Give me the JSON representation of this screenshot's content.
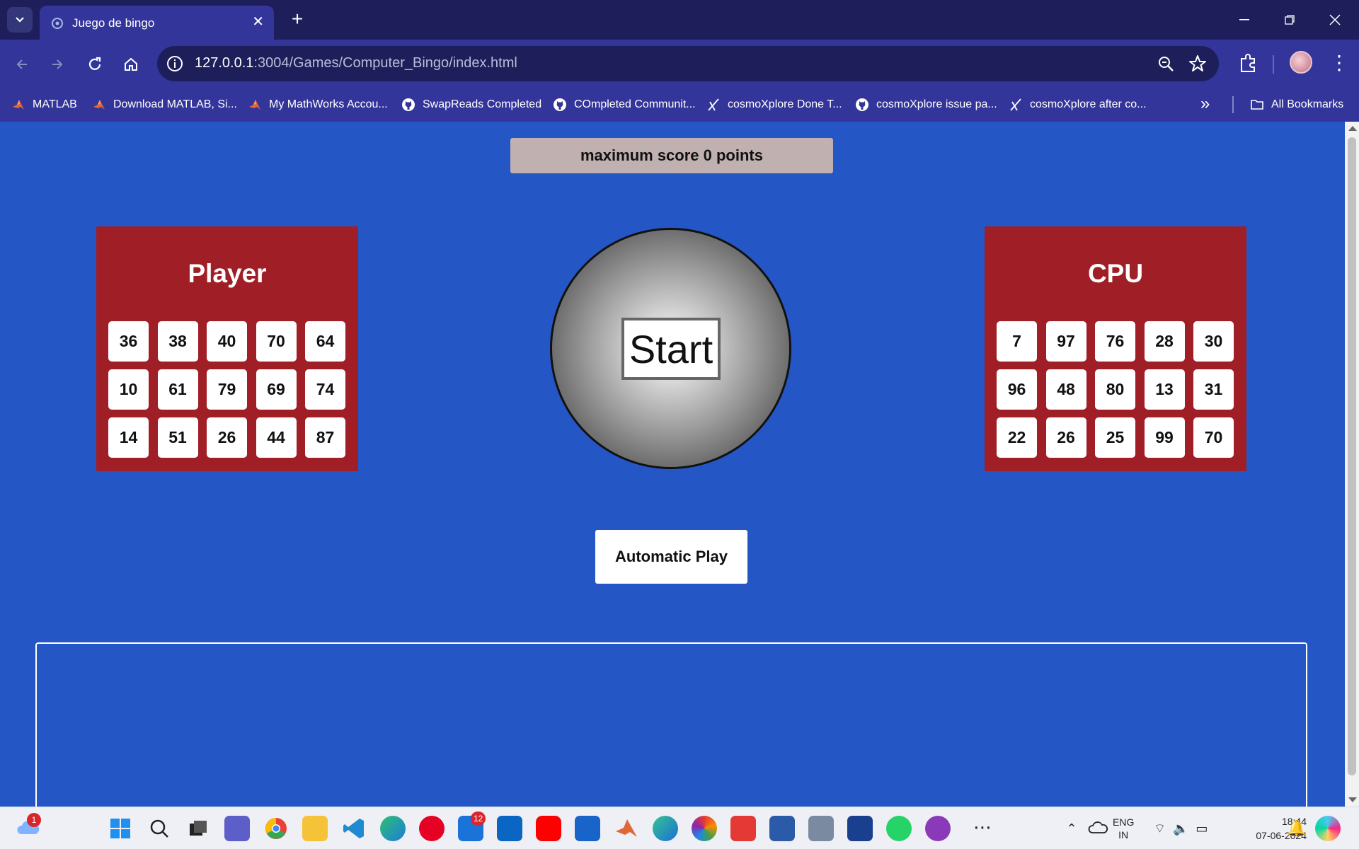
{
  "browser": {
    "tab_title": "Juego de bingo",
    "url_host": "127.0.0.1",
    "url_rest": ":3004/Games/Computer_Bingo/index.html",
    "bookmarks": [
      {
        "label": "MATLAB",
        "icon": "matlab-icon"
      },
      {
        "label": "Download MATLAB, Si...",
        "icon": "matlab-icon"
      },
      {
        "label": "My MathWorks Accou...",
        "icon": "matlab-icon"
      },
      {
        "label": "SwapReads Completed",
        "icon": "github-icon"
      },
      {
        "label": "COmpleted Communit...",
        "icon": "github-icon"
      },
      {
        "label": "cosmoXplore Done T...",
        "icon": "cosmo-icon"
      },
      {
        "label": "cosmoXplore issue pa...",
        "icon": "github-icon"
      },
      {
        "label": "cosmoXplore after co...",
        "icon": "cosmo-icon"
      }
    ],
    "all_bookmarks": "All Bookmarks"
  },
  "game": {
    "score_text": "maximum score 0 points",
    "player": {
      "title": "Player",
      "numbers": [
        "36",
        "38",
        "40",
        "70",
        "64",
        "10",
        "61",
        "79",
        "69",
        "74",
        "14",
        "51",
        "26",
        "44",
        "87"
      ]
    },
    "cpu": {
      "title": "CPU",
      "numbers": [
        "7",
        "97",
        "76",
        "28",
        "30",
        "96",
        "48",
        "80",
        "13",
        "31",
        "22",
        "26",
        "25",
        "99",
        "70"
      ]
    },
    "start_label": "Start",
    "auto_play_label": "Automatic Play",
    "log_text": ""
  },
  "taskbar": {
    "weather_badge": "1",
    "mail_badge": "12",
    "lang_line1": "ENG",
    "lang_line2": "IN",
    "time": "18:44",
    "date": "07-06-2024"
  },
  "colors": {
    "page_bg": "#2457c5",
    "card_bg": "#a01e25",
    "score_bg": "#c0b0b0"
  }
}
